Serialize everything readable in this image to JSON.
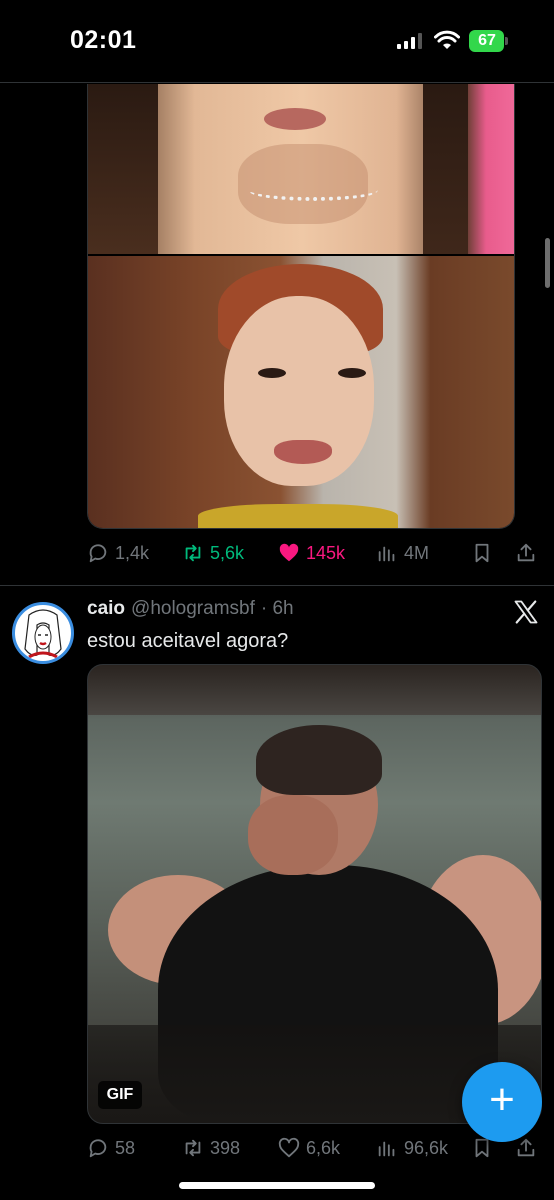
{
  "status_bar": {
    "time": "02:01",
    "battery_level": "67",
    "icons": [
      "signal-icon",
      "wifi-icon",
      "battery-charging-icon"
    ]
  },
  "tweet_1": {
    "media": [
      "photo",
      "photo"
    ],
    "stats": {
      "replies": "1,4k",
      "retweets": "5,6k",
      "likes": "145k",
      "views": "4M"
    }
  },
  "tweet_2": {
    "author_name": "caio",
    "author_handle": "@hologramsbf",
    "time": "· 6h",
    "text": "estou aceitavel agora?",
    "media_badge": "GIF",
    "stats": {
      "replies": "58",
      "retweets": "398",
      "likes": "6,6k",
      "views": "96,6k"
    }
  },
  "fab": {
    "label": "+"
  },
  "colors": {
    "background": "#000000",
    "accent": "#1d9bf0",
    "retweet_active": "#00ba7c",
    "like_active": "#f91880",
    "muted": "#71767b"
  }
}
